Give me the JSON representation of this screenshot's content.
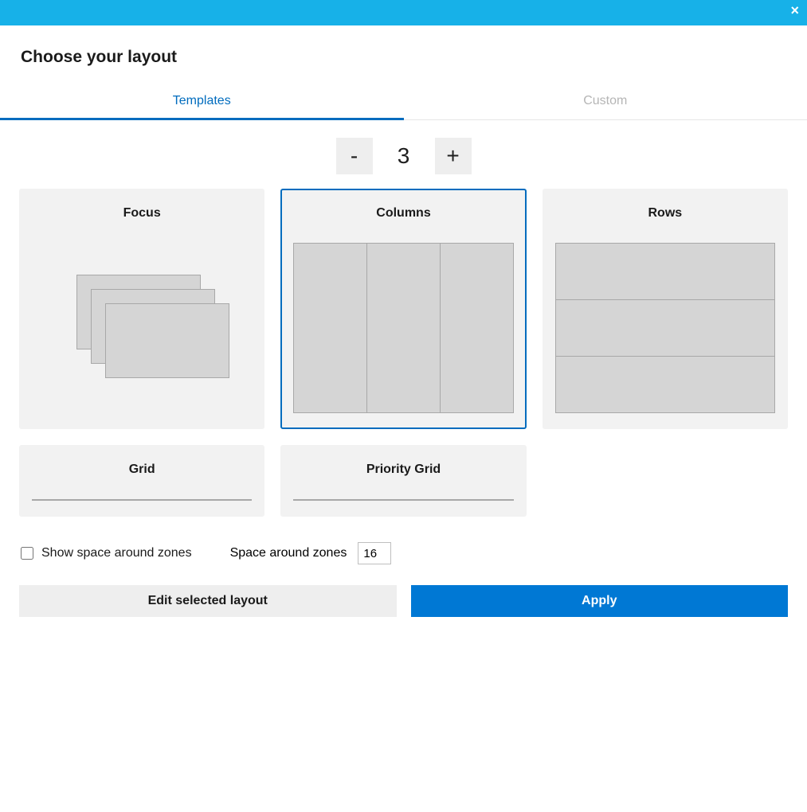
{
  "header": {
    "title": "Choose your layout"
  },
  "tabs": {
    "templates": "Templates",
    "custom": "Custom",
    "active": "templates"
  },
  "stepper": {
    "minus": "-",
    "plus": "+",
    "value": "3"
  },
  "layouts": {
    "focus": "Focus",
    "columns": "Columns",
    "rows": "Rows",
    "grid": "Grid",
    "priority_grid": "Priority Grid",
    "selected": "columns"
  },
  "options": {
    "show_space_label": "Show space around zones",
    "show_space_checked": false,
    "space_label": "Space around zones",
    "space_value": "16"
  },
  "footer": {
    "edit_label": "Edit selected layout",
    "apply_label": "Apply"
  }
}
